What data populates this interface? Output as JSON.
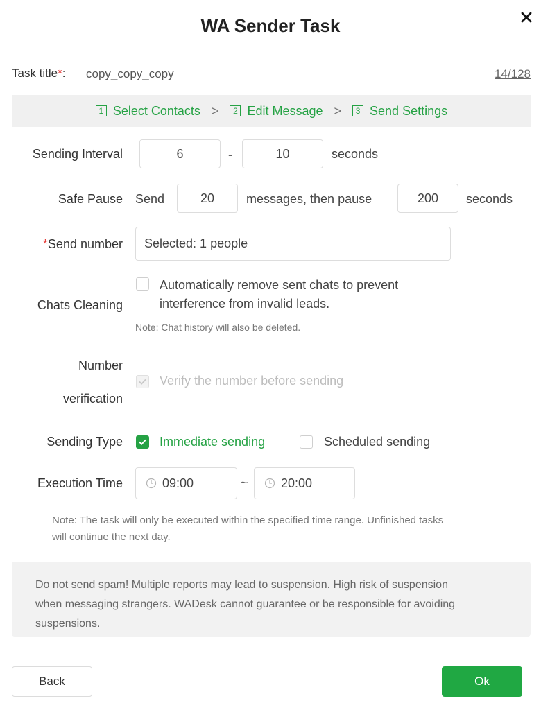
{
  "dialog": {
    "title": "WA Sender Task",
    "close_icon": "close-icon"
  },
  "task_title": {
    "label": "Task title",
    "required_mark": "*",
    "colon": ":",
    "value": "copy_copy_copy",
    "counter": "14/128"
  },
  "steps": [
    {
      "number": "1",
      "label": "Select Contacts"
    },
    {
      "number": "2",
      "label": "Edit Message"
    },
    {
      "number": "3",
      "label": "Send Settings"
    }
  ],
  "step_separator": ">",
  "sending_interval": {
    "label": "Sending Interval",
    "min": "6",
    "dash": "-",
    "max": "10",
    "unit": "seconds"
  },
  "safe_pause": {
    "label": "Safe Pause",
    "prefix": "Send",
    "messages": "20",
    "middle": "messages, then pause",
    "pause": "200",
    "unit": "seconds"
  },
  "send_number": {
    "required_mark": "*",
    "label": "Send number",
    "value": "Selected: 1 people"
  },
  "chats_cleaning": {
    "label": "Chats Cleaning",
    "checked": false,
    "option_line1": "Automatically remove sent chats to prevent",
    "option_line2": "interference from invalid leads.",
    "note": "Note: Chat history will also be deleted."
  },
  "number_verification": {
    "label_line1": "Number",
    "label_line2": "verification",
    "checked": true,
    "disabled": true,
    "option": "Verify the number before sending"
  },
  "sending_type": {
    "label": "Sending Type",
    "immediate": {
      "label": "Immediate sending",
      "checked": true
    },
    "scheduled": {
      "label": "Scheduled sending",
      "checked": false
    }
  },
  "execution_time": {
    "label": "Execution Time",
    "start": "09:00",
    "tilde": "~",
    "end": "20:00",
    "icon": "clock-icon",
    "note_line1": "Note: The task will only be executed within the specified time range. Unfinished tasks",
    "note_line2": "will continue the next day."
  },
  "warning": {
    "line1": "Do not send spam! Multiple reports may lead to suspension. High risk of suspension",
    "line2": "when messaging strangers. WADesk cannot guarantee or be responsible for avoiding",
    "line3": "suspensions."
  },
  "buttons": {
    "back": "Back",
    "ok": "Ok"
  },
  "colors": {
    "accent_green": "#25a244",
    "ok_button": "#20a843",
    "required_red": "#e53935",
    "steps_background": "#f0f0f0",
    "warning_background": "#f2f2f2"
  }
}
